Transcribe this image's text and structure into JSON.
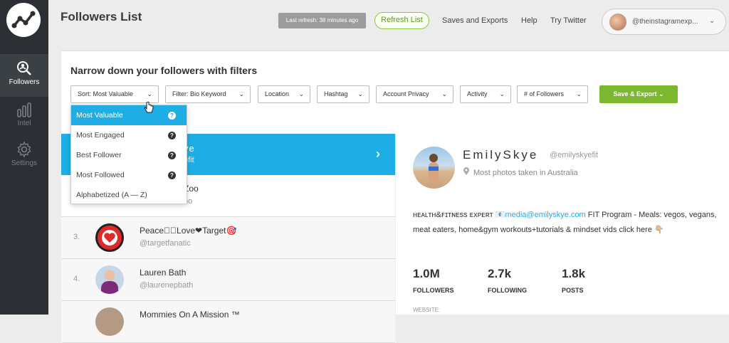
{
  "sidebar": {
    "items": [
      {
        "label": "Followers",
        "icon": "magnifier-people-icon",
        "active": true
      },
      {
        "label": "Intel",
        "icon": "bar-chart-icon",
        "active": false
      },
      {
        "label": "Settings",
        "icon": "gear-icon",
        "active": false
      }
    ]
  },
  "header": {
    "title": "Followers List",
    "last_refresh": "Last refresh: 38 minutes ago",
    "refresh_button": "Refresh List",
    "links": [
      "Saves and Exports",
      "Help",
      "Try Twitter"
    ],
    "account": "@theinstagramexp..."
  },
  "filters": {
    "title": "Narrow down your followers with filters",
    "items": [
      "Sort: Most Valuable",
      "Filter: Bio Keyword",
      "Location",
      "Hashtag",
      "Account Privacy",
      "Activity",
      "# of Followers"
    ],
    "save_export": "Save & Export"
  },
  "sort_dropdown": {
    "options": [
      "Most Valuable",
      "Most Engaged",
      "Best Follower",
      "Most Followed",
      "Alphabetized (A — Z)"
    ],
    "selected": "Most Valuable"
  },
  "followers": {
    "selected": {
      "name": "ye",
      "handle": "efit"
    },
    "rows": [
      {
        "rank": "",
        "name": "Zoo",
        "handle": "bo"
      },
      {
        "rank": "3.",
        "name": "Peace☮🏽Love❤Target🎯",
        "handle": "@targetfanatic"
      },
      {
        "rank": "4.",
        "name": "Lauren Bath",
        "handle": "@laurenepbath"
      },
      {
        "rank": "",
        "name": "Mommies On A Mission ™",
        "handle": ""
      }
    ]
  },
  "profile": {
    "name": "EmilySkye",
    "handle": "@emilyskyefit",
    "location": "Most photos taken in Australia",
    "bio_prefix": "ʜᴇᴀʟᴛʜ&ꜰɪᴛɴᴇss ᴇxᴘᴇʀᴛ 📧",
    "bio_link": "media@emilyskye.com",
    "bio_rest": " FIT Program - Meals: vegos, vegans, meat eaters, home&gym workouts+tutorials & mindset vids click here 👇🏼",
    "stats": [
      {
        "value": "1.0M",
        "label": "FOLLOWERS"
      },
      {
        "value": "2.7k",
        "label": "FOLLOWING"
      },
      {
        "value": "1.8k",
        "label": "POSTS"
      }
    ],
    "website_label": "WEBSITE:"
  },
  "colors": {
    "accent": "#1eaee5",
    "green": "#7cb82f",
    "sidebar": "#2c3034"
  }
}
